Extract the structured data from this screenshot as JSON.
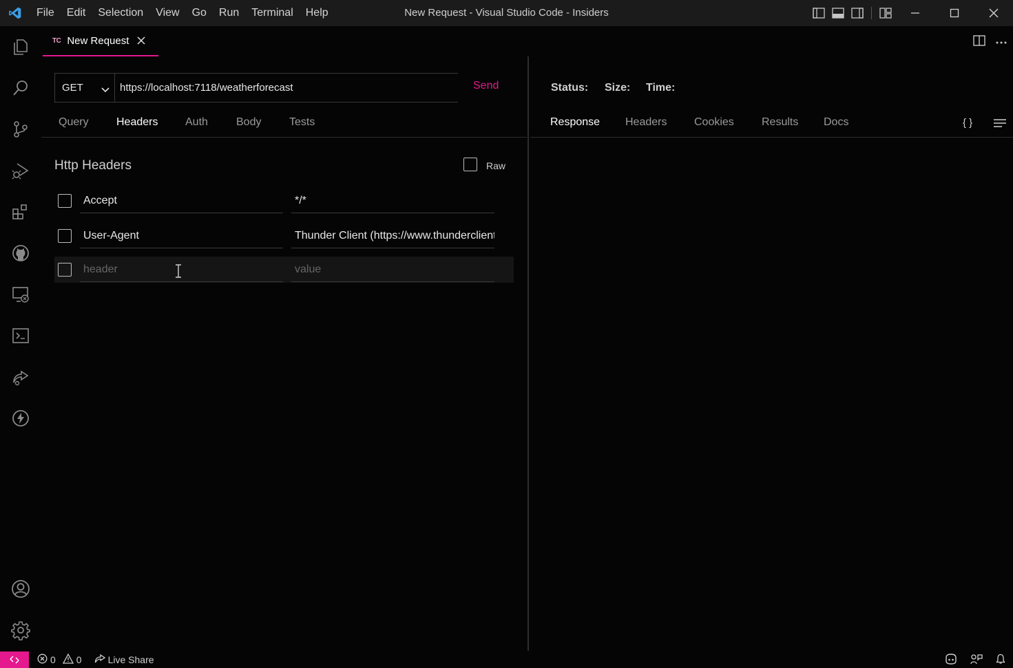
{
  "titlebar": {
    "menu": [
      "File",
      "Edit",
      "Selection",
      "View",
      "Go",
      "Run",
      "Terminal",
      "Help"
    ],
    "title": "New Request - Visual Studio Code - Insiders"
  },
  "tab": {
    "badge": "TC",
    "label": "New Request"
  },
  "request": {
    "method": "GET",
    "url": "https://localhost:7118/weatherforecast",
    "send_label": "Send",
    "tabs": [
      "Query",
      "Headers",
      "Auth",
      "Body",
      "Tests"
    ],
    "active_tab": "Headers"
  },
  "headers_section": {
    "title": "Http Headers",
    "raw_label": "Raw",
    "rows": [
      {
        "key": "Accept",
        "value": "*/*"
      },
      {
        "key": "User-Agent",
        "value": "Thunder Client (https://www.thunderclient.com)"
      }
    ],
    "new_row": {
      "key_placeholder": "header",
      "value_placeholder": "value"
    }
  },
  "response": {
    "status_label": "Status:",
    "size_label": "Size:",
    "time_label": "Time:",
    "tabs": [
      "Response",
      "Headers",
      "Cookies",
      "Results",
      "Docs"
    ],
    "active_tab": "Response",
    "braces": "{ }"
  },
  "statusbar": {
    "errors": "0",
    "warnings": "0",
    "live_share": "Live Share"
  },
  "colors": {
    "accent": "#e5188e",
    "vscode_blue": "#3c9ee8",
    "background": "#050505",
    "titlebar": "#1b1b1b"
  },
  "icons": {
    "activity_bar": [
      "explorer-icon",
      "search-icon",
      "source-control-icon",
      "run-debug-icon",
      "extensions-icon",
      "github-icon",
      "remote-explorer-icon",
      "terminal-icon",
      "live-share-icon",
      "thunder-client-icon",
      "account-icon",
      "settings-gear-icon"
    ]
  }
}
